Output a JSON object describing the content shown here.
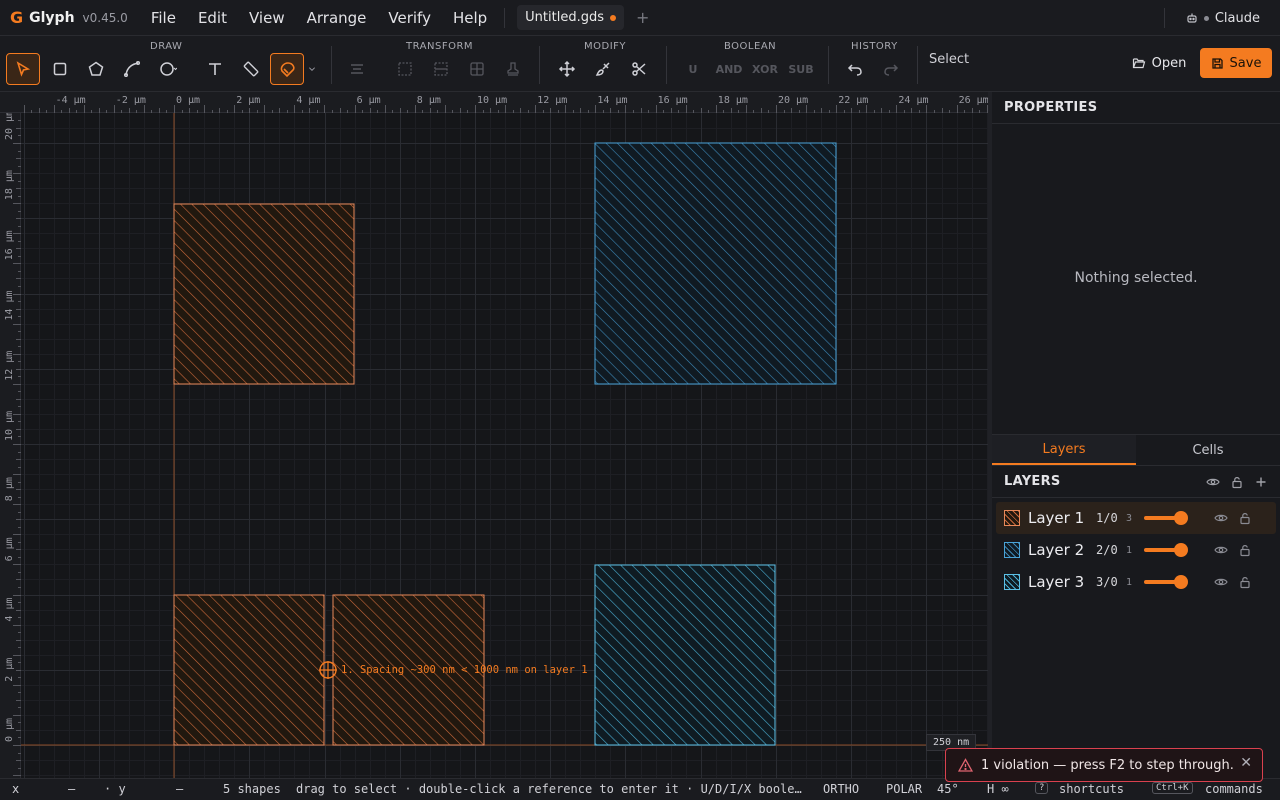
{
  "app": {
    "logo": "G",
    "name": "Glyph",
    "version": "v0.45.0"
  },
  "menu": [
    "File",
    "Edit",
    "View",
    "Arrange",
    "Verify",
    "Help"
  ],
  "document_tab": {
    "title": "Untitled.gds",
    "unsaved": true,
    "new_tab_glyph": "+"
  },
  "user": {
    "name": "Claude"
  },
  "toolbar": {
    "groups": {
      "draw": "DRAW",
      "transform": "TRANSFORM",
      "modify": "MODIFY",
      "boolean": "BOOLEAN",
      "history": "HISTORY"
    },
    "boolean_ops": [
      "U",
      "AND",
      "XOR",
      "SUB"
    ],
    "mode": "Select",
    "open_label": "Open",
    "save_label": "Save",
    "accent": "#f47b20"
  },
  "canvas": {
    "ruler_x_labels": [
      "-4 µm",
      "-2 µm",
      "0 µm",
      "2 µm",
      "4 µm",
      "6 µm",
      "8 µm",
      "10 µm",
      "12 µm",
      "14 µm",
      "16 µm",
      "18 µm",
      "20 µm",
      "22 µm",
      "24 µm",
      "26 µm"
    ],
    "ruler_y_labels": [
      "20 µm",
      "18 µm",
      "16 µm",
      "14 µm",
      "12 µm",
      "10 µm",
      "8 µm",
      "6 µm",
      "4 µm",
      "2 µm",
      "0 µm"
    ],
    "scale": "250 nm",
    "violation_marker": "1. Spacing ~300 nm < 1000 nm on layer 1",
    "layer_colors": {
      "layer1": "#e8895a",
      "layer2": "#4aa3d8",
      "layer3": "#5cc0e6"
    }
  },
  "properties": {
    "title": "PROPERTIES",
    "empty": "Nothing selected."
  },
  "panel_tabs": [
    "Layers",
    "Cells"
  ],
  "layers": {
    "title": "LAYERS",
    "items": [
      {
        "name": "Layer 1",
        "gds": "1/0",
        "count": "3",
        "color": "#e8895a",
        "opacity": 1.0,
        "selected": true
      },
      {
        "name": "Layer 2",
        "gds": "2/0",
        "count": "1",
        "color": "#4aa3d8",
        "opacity": 1.0,
        "selected": false
      },
      {
        "name": "Layer 3",
        "gds": "3/0",
        "count": "1",
        "color": "#5cc0e6",
        "opacity": 1.0,
        "selected": false
      }
    ]
  },
  "status": {
    "x_label": "x",
    "x_val": "—",
    "y_label": "· y",
    "y_val": "—",
    "shapes": "5 shapes",
    "hint": "drag to select · double-click a reference to enter it · U/D/I/X boole…",
    "ortho": "ORTHO",
    "polar": "POLAR",
    "angle": "45°",
    "h": "H ∞",
    "shortcuts_key": "?",
    "shortcuts": "shortcuts",
    "commands_key": "Ctrl+K",
    "commands": "commands"
  },
  "toast": {
    "message": "1 violation — press F2 to step through.",
    "close": "✕"
  }
}
